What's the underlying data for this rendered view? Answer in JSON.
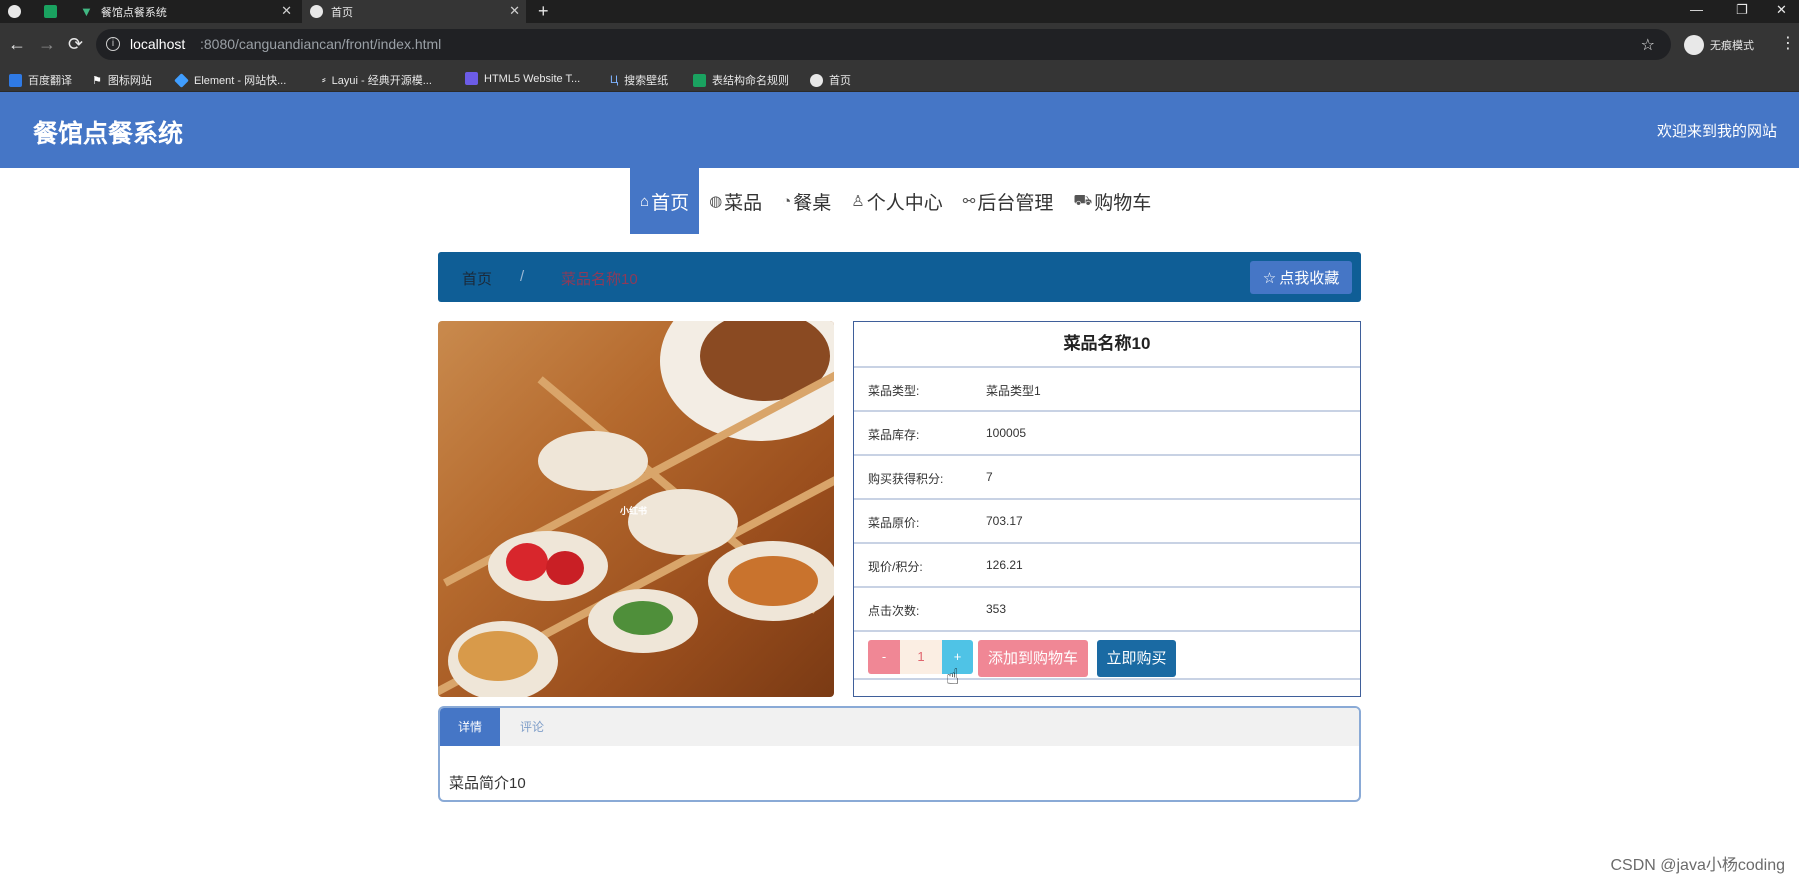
{
  "browser": {
    "tabs": [
      {
        "label": "",
        "icon": "globe-icon"
      },
      {
        "label": "",
        "icon": "spreadsheet-icon"
      },
      {
        "label": "餐馆点餐系统",
        "icon": "vue-icon"
      },
      {
        "label": "首页",
        "icon": "globe-icon"
      }
    ],
    "url_host": "localhost",
    "url_path": ":8080/canguandiancan/front/index.html",
    "incognito_label": "无痕模式",
    "bookmarks": [
      {
        "label": "百度翻译",
        "icon": "translate-icon"
      },
      {
        "label": "图标网站",
        "icon": "flag-icon"
      },
      {
        "label": "Element - 网站快...",
        "icon": "element-icon"
      },
      {
        "label": "Layui - 经典开源模...",
        "icon": "layui-icon"
      },
      {
        "label": "HTML5 Website T...",
        "icon": "html5-icon"
      },
      {
        "label": "搜索壁纸",
        "icon": "wallpaper-icon"
      },
      {
        "label": "表结构命名规则",
        "icon": "sheet-icon"
      },
      {
        "label": "首页",
        "icon": "globe-icon"
      }
    ]
  },
  "site": {
    "title": "餐馆点餐系统",
    "welcome": "欢迎来到我的网站",
    "nav": [
      {
        "label": "首页",
        "icon": "home-icon",
        "active": true
      },
      {
        "label": "菜品",
        "icon": "globe-icon",
        "active": false
      },
      {
        "label": "餐桌",
        "icon": "palette-icon",
        "active": false
      },
      {
        "label": "个人中心",
        "icon": "user-icon",
        "active": false
      },
      {
        "label": "后台管理",
        "icon": "link-icon",
        "active": false
      },
      {
        "label": "购物车",
        "icon": "cart-icon",
        "active": false
      }
    ],
    "breadcrumb": {
      "home": "首页",
      "separator": "/",
      "current": "菜品名称10"
    },
    "favorite_button": "点我收藏"
  },
  "product": {
    "image_overlay_text": "小红书",
    "name": "菜品名称10",
    "rows": [
      {
        "key": "菜品类型:",
        "value": "菜品类型1"
      },
      {
        "key": "菜品库存:",
        "value": "100005"
      },
      {
        "key": "购买获得积分:",
        "value": "7"
      },
      {
        "key": "菜品原价:",
        "value": "703.17"
      },
      {
        "key": "现价/积分:",
        "value": "126.21"
      },
      {
        "key": "点击次数:",
        "value": "353"
      }
    ],
    "quantity": "1",
    "minus_label": "-",
    "plus_label": "+",
    "add_to_cart_label": "添加到购物车",
    "buy_now_label": "立即购买"
  },
  "detail": {
    "tabs": [
      {
        "label": "详情",
        "active": true
      },
      {
        "label": "评论",
        "active": false
      }
    ],
    "content": "菜品简介10"
  },
  "watermark": "CSDN @java小杨coding",
  "colors": {
    "primary": "#4576c6",
    "breadcrumb": "#0f5e96",
    "add_cart": "#f08795",
    "buy_now": "#1a6aa3",
    "plus": "#4fc3e6"
  }
}
